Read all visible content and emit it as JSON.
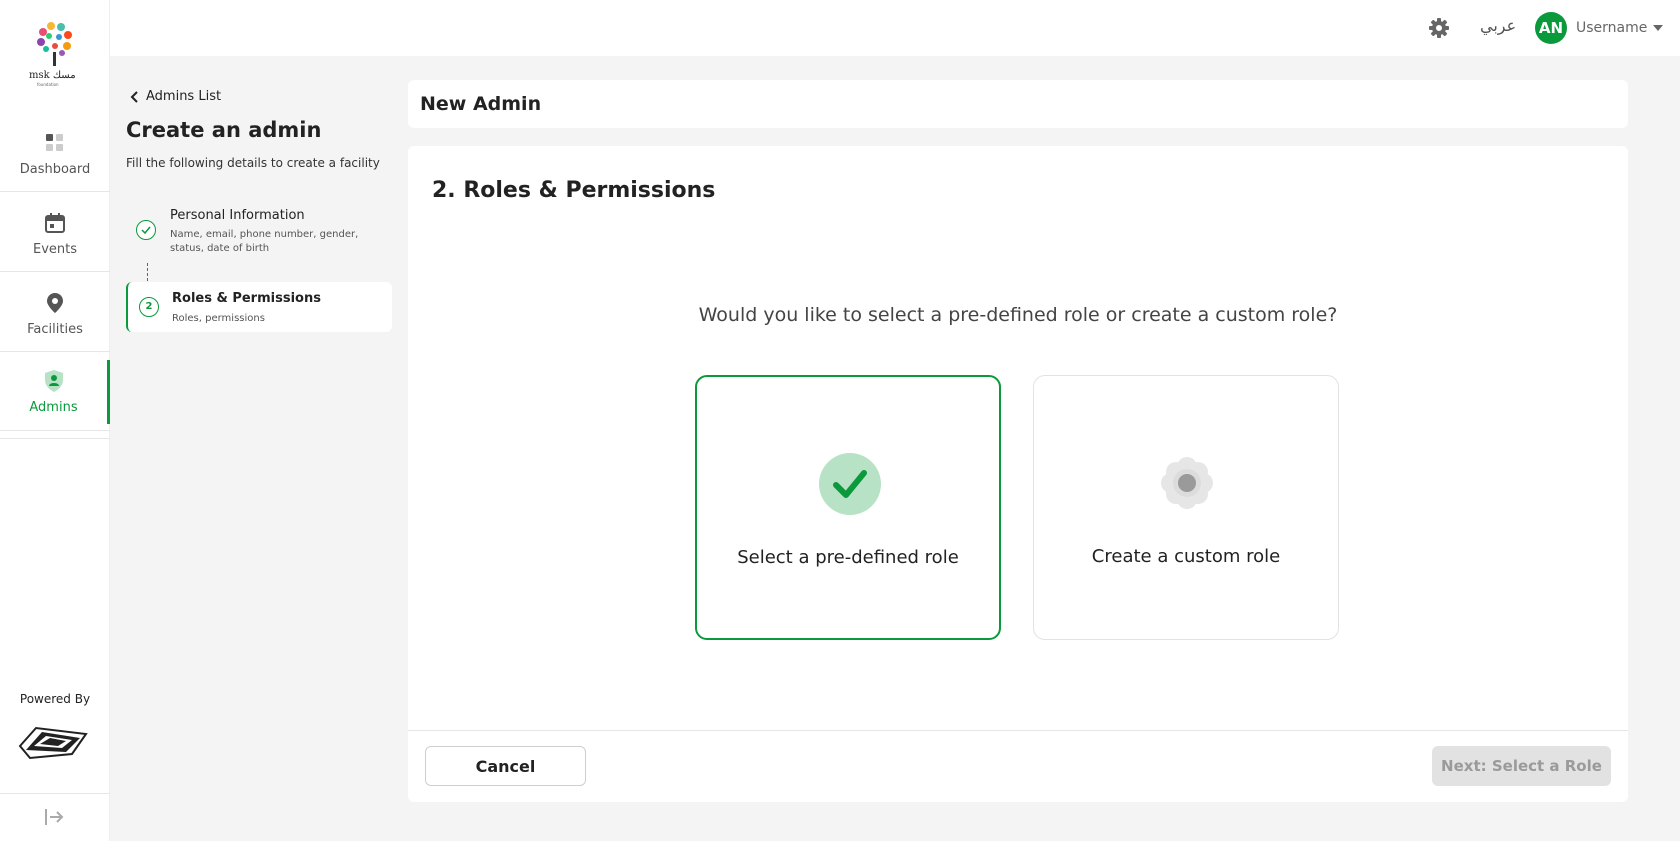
{
  "sidebar": {
    "logo_alt": "msk",
    "items": [
      {
        "label": "Dashboard",
        "icon": "dashboard-icon",
        "active": false
      },
      {
        "label": "Events",
        "icon": "calendar-icon",
        "active": false
      },
      {
        "label": "Facilities",
        "icon": "location-pin-icon",
        "active": false
      },
      {
        "label": "Admins",
        "icon": "admin-shield-icon",
        "active": true
      }
    ],
    "powered_by": "Powered By",
    "logout_icon": "logout-icon"
  },
  "topbar": {
    "settings_icon": "gear-icon",
    "language": "عربي",
    "avatar_initials": "AN",
    "username": "Username"
  },
  "steps_panel": {
    "back_label": "Admins List",
    "title": "Create an admin",
    "subtitle": "Fill the following details to create a facility",
    "steps": [
      {
        "title": "Personal Information",
        "desc": "Name, email, phone number, gender, status, date of birth",
        "status": "completed"
      },
      {
        "number": "2",
        "title": "Roles & Permissions",
        "desc": "Roles, permissions",
        "status": "active"
      }
    ]
  },
  "header": {
    "title": "New Admin"
  },
  "main": {
    "section_title": "2. Roles & Permissions",
    "question": "Would you like to select a pre-defined role or create a custom role?",
    "options": [
      {
        "label": "Select a pre-defined role",
        "icon": "check-circle-icon",
        "selected": true
      },
      {
        "label": "Create a custom role",
        "icon": "gear-icon",
        "selected": false
      }
    ],
    "cancel_label": "Cancel",
    "next_label": "Next: Select a Role"
  },
  "colors": {
    "accent": "#0a9a3c",
    "accent_light": "#b7e2c6",
    "background": "#f4f4f4",
    "disabled": "#e2e2e2"
  }
}
